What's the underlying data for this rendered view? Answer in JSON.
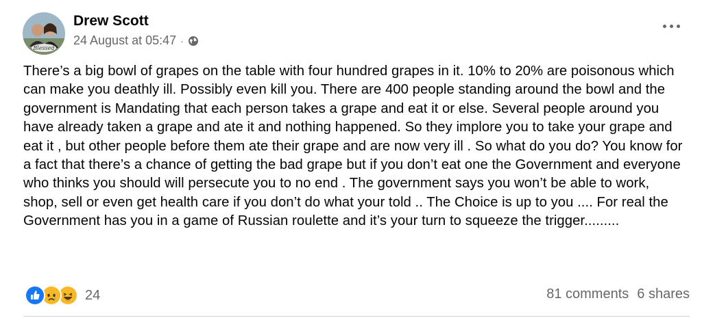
{
  "post": {
    "author": "Drew Scott",
    "timestamp": "24 August at 05:47",
    "separator": "·",
    "privacy_icon": "globe-icon",
    "avatar_caption": "Blessed",
    "body": "There’s a big bowl of grapes on the table with four hundred grapes in it. 10% to 20% are poisonous which can make you deathly ill. Possibly even kill you. There are 400 people standing around the bowl and the government is Mandating that each person takes a grape and eat it or else. Several people around you have already taken a grape and ate it and nothing happened. So they implore you to take your grape and eat it , but other people before them ate their grape and are now very ill . So what do you do? You know for a fact that there’s a chance of getting the bad grape but if you don’t eat one the Government and everyone who thinks you should will persecute you to no end . The government says you won’t be able to work, shop, sell or even get health care if you don’t do what your told .. The Choice is up to you .... For real the Government has you in a game of Russian roulette and it’s your turn to squeeze the trigger.........",
    "reactions": {
      "icons": [
        "like-icon",
        "sad-icon",
        "haha-icon"
      ],
      "count": "24"
    },
    "comments": "81 comments",
    "shares": "6 shares"
  },
  "colors": {
    "text": "#050505",
    "secondary": "#65676b",
    "like_blue": "#1877f2",
    "emoji_yellow": "#f7b928"
  }
}
